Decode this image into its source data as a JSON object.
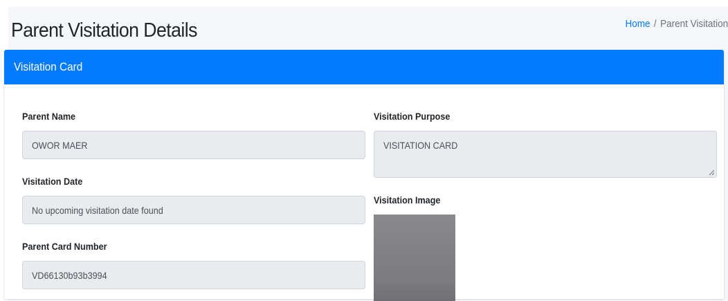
{
  "header": {
    "title": "Parent Visitation Details",
    "breadcrumb": {
      "home": "Home",
      "separator": "/",
      "current": "Parent Visitation"
    }
  },
  "card": {
    "title": "Visitation Card",
    "fields": {
      "parent_name": {
        "label": "Parent Name",
        "value": "OWOR MAER"
      },
      "visitation_date": {
        "label": "Visitation Date",
        "value": "No upcoming visitation date found"
      },
      "parent_card_number": {
        "label": "Parent Card Number",
        "value": "VD66130b93b3994"
      },
      "visitation_purpose": {
        "label": "Visitation Purpose",
        "value": "VISITATION CARD"
      },
      "visitation_image": {
        "label": "Visitation Image"
      }
    }
  },
  "colors": {
    "primary": "#007bff",
    "field_background": "#e9ecef",
    "page_background": "#f4f6f9"
  }
}
